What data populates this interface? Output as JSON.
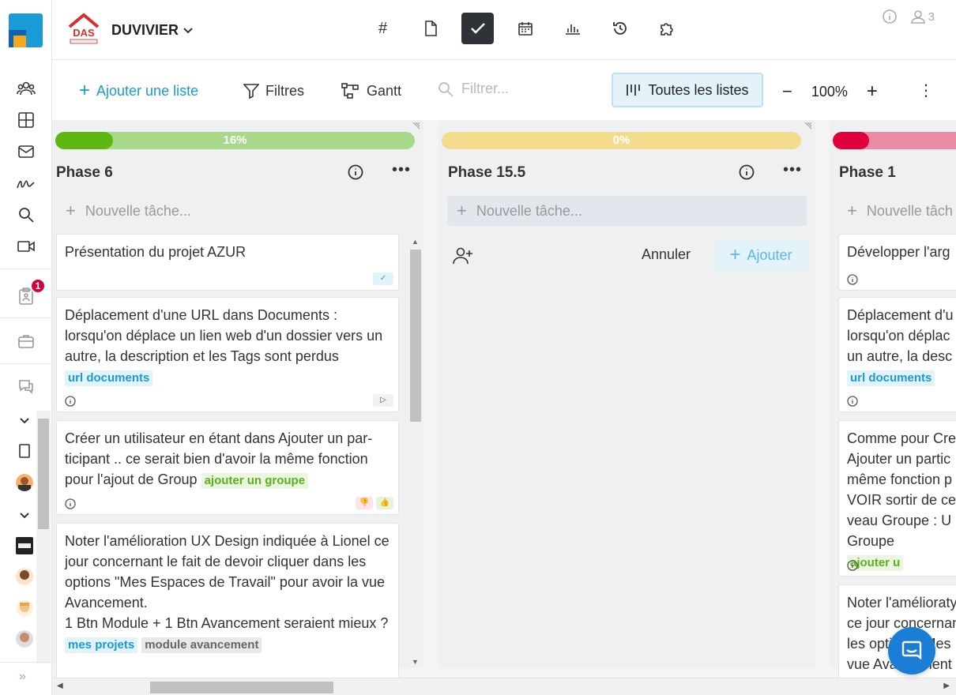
{
  "app": {
    "colors": {
      "accent": "#1a9ad6",
      "dark_tab": "#2f3337",
      "badge": "#d6003a"
    }
  },
  "rail": {
    "icons": [
      "app-logo",
      "users-icon",
      "grid-icon",
      "mail-icon",
      "signature-icon",
      "search-icon",
      "video-icon",
      "clipboard-icon",
      "briefcase-icon",
      "chat-icon",
      "chevron-down-icon",
      "document-icon",
      "chevron-down-icon"
    ],
    "notification_count": "1",
    "expand_icon": "double-chevron-right-icon"
  },
  "header": {
    "company_name": "DUVIVIER",
    "tabs": [
      {
        "icon": "hash-icon",
        "glyph": "#",
        "active": false
      },
      {
        "icon": "document-icon",
        "active": false
      },
      {
        "icon": "check-icon",
        "active": true
      },
      {
        "icon": "calendar-icon",
        "active": false
      },
      {
        "icon": "bar-chart-icon",
        "active": false
      },
      {
        "icon": "history-icon",
        "active": false
      },
      {
        "icon": "puzzle-icon",
        "active": false
      }
    ],
    "participants_count": "3"
  },
  "toolbar": {
    "add_list": "Ajouter une liste",
    "filters": "Filtres",
    "gantt": "Gantt",
    "filter_placeholder": "Filtrer...",
    "all_lists": "Toutes les listes",
    "zoom_minus": "−",
    "zoom_level": "100%",
    "zoom_plus": "+",
    "more": "⋮"
  },
  "columns": [
    {
      "title": "Phase 6",
      "progress_label": "16%",
      "progress": 0.16,
      "progress_color": "#5cb811",
      "progress_track": "#a8d98a",
      "new_task_placeholder": "Nouvelle tâche...",
      "cards": [
        {
          "text": "Présentation du projet AZUR",
          "tags": []
        },
        {
          "text": "Déplacement d'une URL dans Documents : lorsqu'on déplace un lien web d'un dossier vers un autre, la description et les Tags sont perdus",
          "tags": [
            {
              "label": "url documents",
              "color": "blue"
            }
          ]
        },
        {
          "text": "Créer un utilisateur en étant dans Ajouter un par-ticipant .. ce serait bien d'avoir la même fonction pour l'ajout de Group",
          "tags": [
            {
              "label": "ajouter un groupe",
              "color": "green"
            }
          ]
        },
        {
          "text": "Noter l'amélioration UX Design indiquée à Lionel ce jour concernant le fait de devoir cliquer dans les options \"Mes Espaces de Travail\" pour avoir la vue Avancement.\n1 Btn Module + 1 Btn Avancement seraient mieux ?",
          "tags": [
            {
              "label": "mes projets",
              "color": "blue"
            },
            {
              "label": "module avancement",
              "color": "gray"
            }
          ]
        }
      ]
    },
    {
      "title": "Phase 15.5",
      "progress_label": "0%",
      "progress": 0,
      "progress_color": "#f3dc8b",
      "progress_track": "#f3dc8b",
      "new_task_placeholder": "Nouvelle tâche...",
      "cancel_label": "Annuler",
      "add_label": "Ajouter",
      "cards": []
    },
    {
      "title": "Phase 1",
      "progress_label": "",
      "progress": 0.3,
      "progress_color": "#e0003c",
      "progress_track": "#eb8aa3",
      "new_task_placeholder": "Nouvelle tâch",
      "cards": [
        {
          "text": "Développer l'arg",
          "tags": []
        },
        {
          "text": "Déplacement d'u lorsqu'on déplac un autre, la desc",
          "tags": [
            {
              "label": "url documents",
              "color": "blue"
            }
          ]
        },
        {
          "text": "Comme pour Cre Ajouter un partic même fonction p VOIR sortir de ce veau Groupe :  U Groupe",
          "tags": [
            {
              "label": "ajouter u",
              "color": "green"
            }
          ]
        },
        {
          "text": "Noter l'amélioraty ce jour concernan les options \"Mes vue Avancement",
          "tags": []
        }
      ]
    }
  ]
}
